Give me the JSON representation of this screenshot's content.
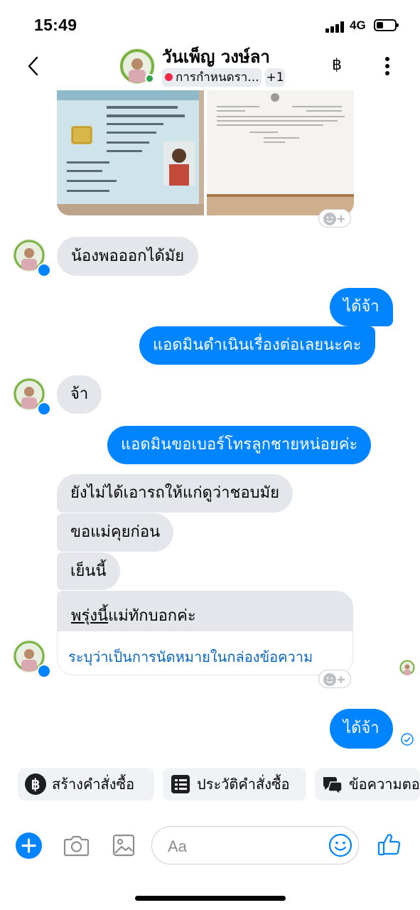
{
  "status_bar": {
    "time": "15:49",
    "network": "4G"
  },
  "header": {
    "contact_name": "วันเพ็ญ วงษ์ลา",
    "label_chip": "การกำหนดรา...",
    "extra_labels": "+1",
    "baht_icon": "฿"
  },
  "messages": [
    {
      "side": "in",
      "text": "น้องพอออกได้มัย"
    },
    {
      "side": "out",
      "text": "ได้จ้า"
    },
    {
      "side": "out",
      "text": "แอดมินดำเนินเรื่องต่อเลยนะคะ"
    },
    {
      "side": "in",
      "text": "จ้า"
    },
    {
      "side": "out",
      "text": "แอดมินขอเบอร์โทรลูกชายหน่อยค่ะ"
    },
    {
      "side": "in",
      "text": "ยังไม่ได้เอารถให้แก่ดูว่าชอบมัย"
    },
    {
      "side": "in",
      "text": "ขอแม่คุยก่อน"
    },
    {
      "side": "in",
      "text": "เย็นนี้"
    },
    {
      "side": "in",
      "text_underlined": "พรุ่งนี้",
      "text_rest": "แม่ทักบอกค่ะ",
      "suggestion": "ระบุว่าเป็นการนัดหมายในกล่องข้อความ"
    },
    {
      "side": "out",
      "text": "ได้จ้า"
    }
  ],
  "quick_actions": [
    {
      "label": "สร้างคำสั่งซื้อ",
      "icon": "baht-circle-icon"
    },
    {
      "label": "ประวัติคำสั่งซื้อ",
      "icon": "order-list-icon"
    },
    {
      "label": "ข้อความตอ",
      "icon": "saved-replies-icon"
    }
  ],
  "composer": {
    "placeholder": "Aa"
  },
  "colors": {
    "accent": "#0084ff",
    "incoming_bubble": "#e4e6eb",
    "chip_dot": "#f02849"
  }
}
